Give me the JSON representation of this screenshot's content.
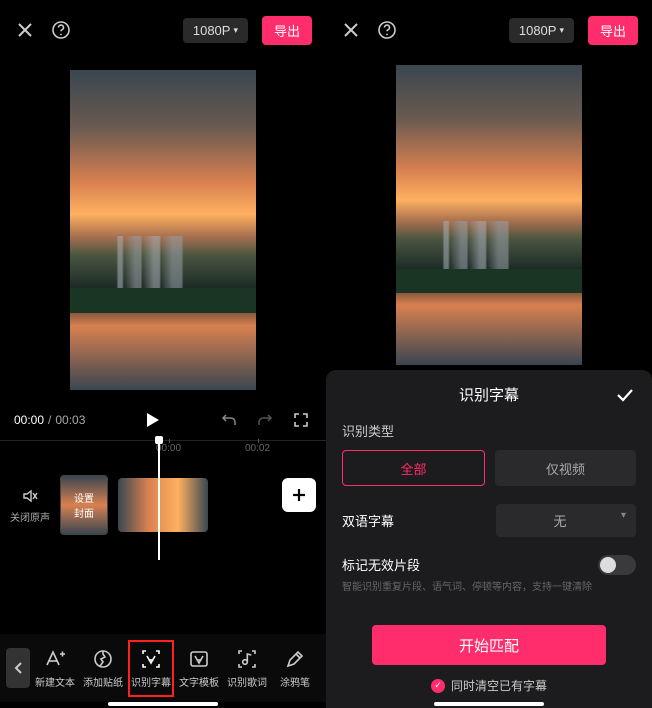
{
  "topbar": {
    "resolution": "1080P",
    "export": "导出"
  },
  "player": {
    "current": "00:00",
    "total": "00:03"
  },
  "ruler": {
    "t1": "00:00",
    "t2": "00:02"
  },
  "timeline": {
    "mute_label": "关闭原声",
    "cover_label": "设置\n封面"
  },
  "toolbar": {
    "items": [
      {
        "name": "new-text",
        "label": "新建文本"
      },
      {
        "name": "add-sticker",
        "label": "添加贴纸"
      },
      {
        "name": "recognize-subtitle",
        "label": "识别字幕"
      },
      {
        "name": "text-template",
        "label": "文字模板"
      },
      {
        "name": "recognize-lyrics",
        "label": "识别歌词"
      },
      {
        "name": "doodle-pen",
        "label": "涂鸦笔"
      }
    ]
  },
  "panel": {
    "title": "识别字幕",
    "type_label": "识别类型",
    "opt_all": "全部",
    "opt_video": "仅视频",
    "bilingual_label": "双语字幕",
    "bilingual_value": "无",
    "invalid_label": "标记无效片段",
    "invalid_desc": "智能识别重复片段、语气词、停顿等内容，支持一键清除",
    "start": "开始匹配",
    "clear_label": "同时清空已有字幕"
  }
}
